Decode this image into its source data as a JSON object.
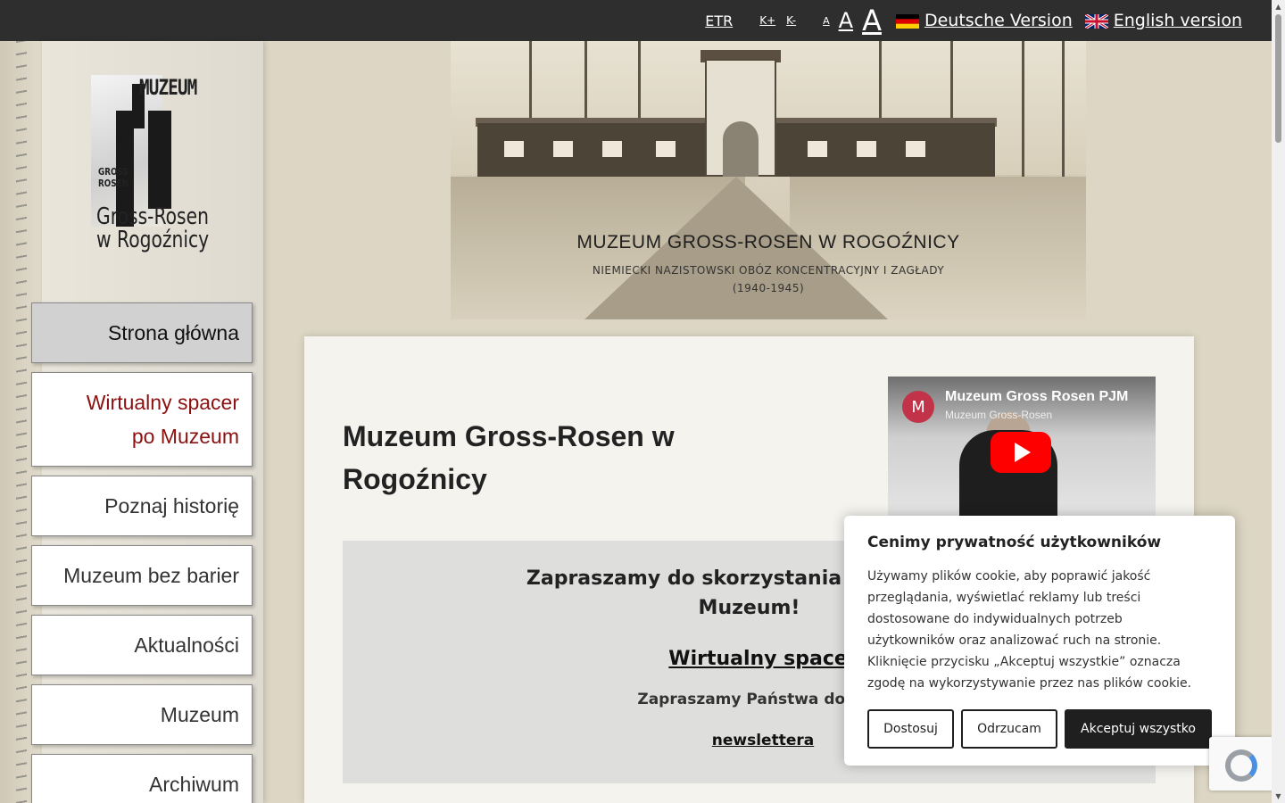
{
  "topbar": {
    "etr": "ETR",
    "contrast_plus": "K+",
    "contrast_minus": "K-",
    "font_small": "A",
    "font_medium": "A",
    "font_large": "A",
    "german": "Deutsche Version",
    "english": "English version"
  },
  "logo": {
    "muzeum": "MUZEUM",
    "gross": "GROSS",
    "rosen": "ROSEN",
    "name_line1": "Gross-Rosen",
    "name_line2": "w Rogoźnicy"
  },
  "nav": {
    "items": [
      {
        "label": "Strona główna"
      },
      {
        "label_line1": "Wirtualny spacer",
        "label_line2": "po Muzeum"
      },
      {
        "label": "Poznaj historię"
      },
      {
        "label": "Muzeum bez barier"
      },
      {
        "label": "Aktualności"
      },
      {
        "label": "Muzeum"
      },
      {
        "label": "Archiwum"
      }
    ]
  },
  "banner": {
    "title": "MUZEUM GROSS-ROSEN W ROGOŹNICY",
    "subtitle": "NIEMIECKI NAZISTOWSKI OBÓZ KONCENTRACYJNY I ZAGŁADY",
    "years": "(1940-1945)"
  },
  "content": {
    "title_line1": "Muzeum Gross-Rosen w",
    "title_line2": "Rogoźnicy",
    "video": {
      "avatar": "M",
      "title": "Muzeum Gross Rosen PJM",
      "channel": "Muzeum Gross-Rosen"
    },
    "promo": {
      "title_line1": "Zapraszamy do skorzystania z wirtualne",
      "title_line2": "Muzeum!",
      "link": "Wirtualny spacer",
      "text": "Zapraszamy Państwa do zapisywania się",
      "newsletter": "newslettera"
    }
  },
  "cookie": {
    "title": "Cenimy prywatność użytkowników",
    "text": "Używamy plików cookie, aby poprawić jakość przeglądania, wyświetlać reklamy lub treści dostosowane do indywidualnych potrzeb użytkowników oraz analizować ruch na stronie. Kliknięcie przycisku „Akceptuj wszystkie” oznacza zgodę na wykorzystywanie przez nas plików cookie.",
    "customize": "Dostosuj",
    "reject": "Odrzucam",
    "accept": "Akceptuj wszystko"
  },
  "colors": {
    "topbar": "#2e2e2e",
    "nav_accent": "#8b1010",
    "button_dark": "#1f1f1f",
    "youtube_red": "#ff0000"
  }
}
